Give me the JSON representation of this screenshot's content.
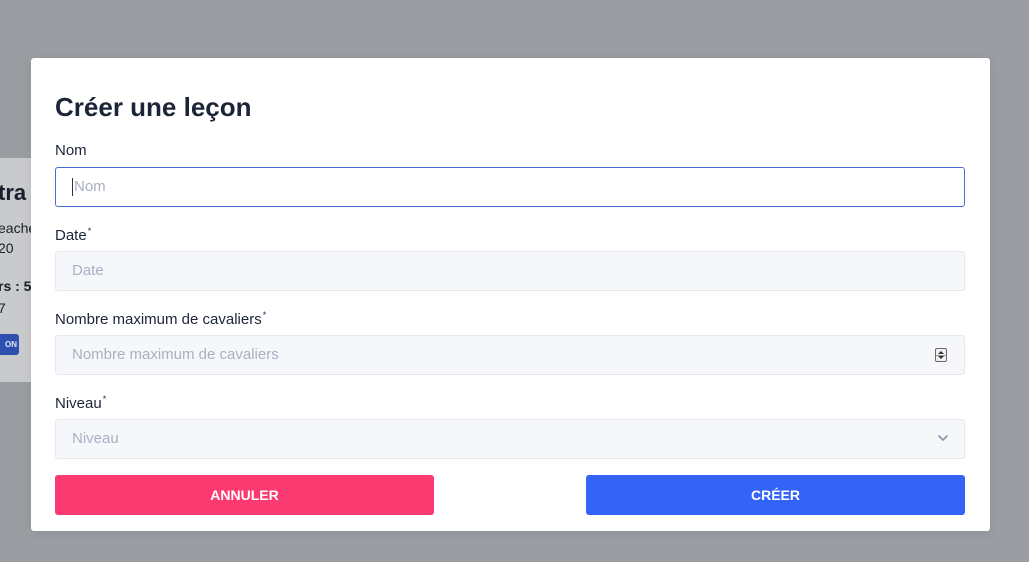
{
  "background_card": {
    "title": "tra",
    "line1": "eache",
    "line2": "20",
    "line3": "rs : 5",
    "line4": "7",
    "button_label": "ON"
  },
  "modal": {
    "title": "Créer une leçon",
    "fields": {
      "nom": {
        "label": "Nom",
        "required": false,
        "value": "",
        "placeholder": "Nom"
      },
      "date": {
        "label": "Date",
        "required": true,
        "required_mark": "*",
        "value": "",
        "placeholder": "Date"
      },
      "max_cavaliers": {
        "label": "Nombre maximum de cavaliers",
        "required": true,
        "required_mark": "*",
        "value": "",
        "placeholder": "Nombre maximum de cavaliers"
      },
      "niveau": {
        "label": "Niveau",
        "required": true,
        "required_mark": "*",
        "selected": "Niveau"
      }
    },
    "buttons": {
      "cancel": "ANNULER",
      "create": "CRÉER"
    }
  },
  "colors": {
    "overlay": "#9a9da2",
    "cancel_button": "#fb3a72",
    "create_button": "#3363f7",
    "focus_border": "#4a6bd8",
    "title_text": "#1c2538",
    "placeholder_text": "#a9b0c2"
  },
  "icons": {
    "number_spinner": "spinner-arrows-icon",
    "select_chevron": "chevron-down-icon"
  }
}
